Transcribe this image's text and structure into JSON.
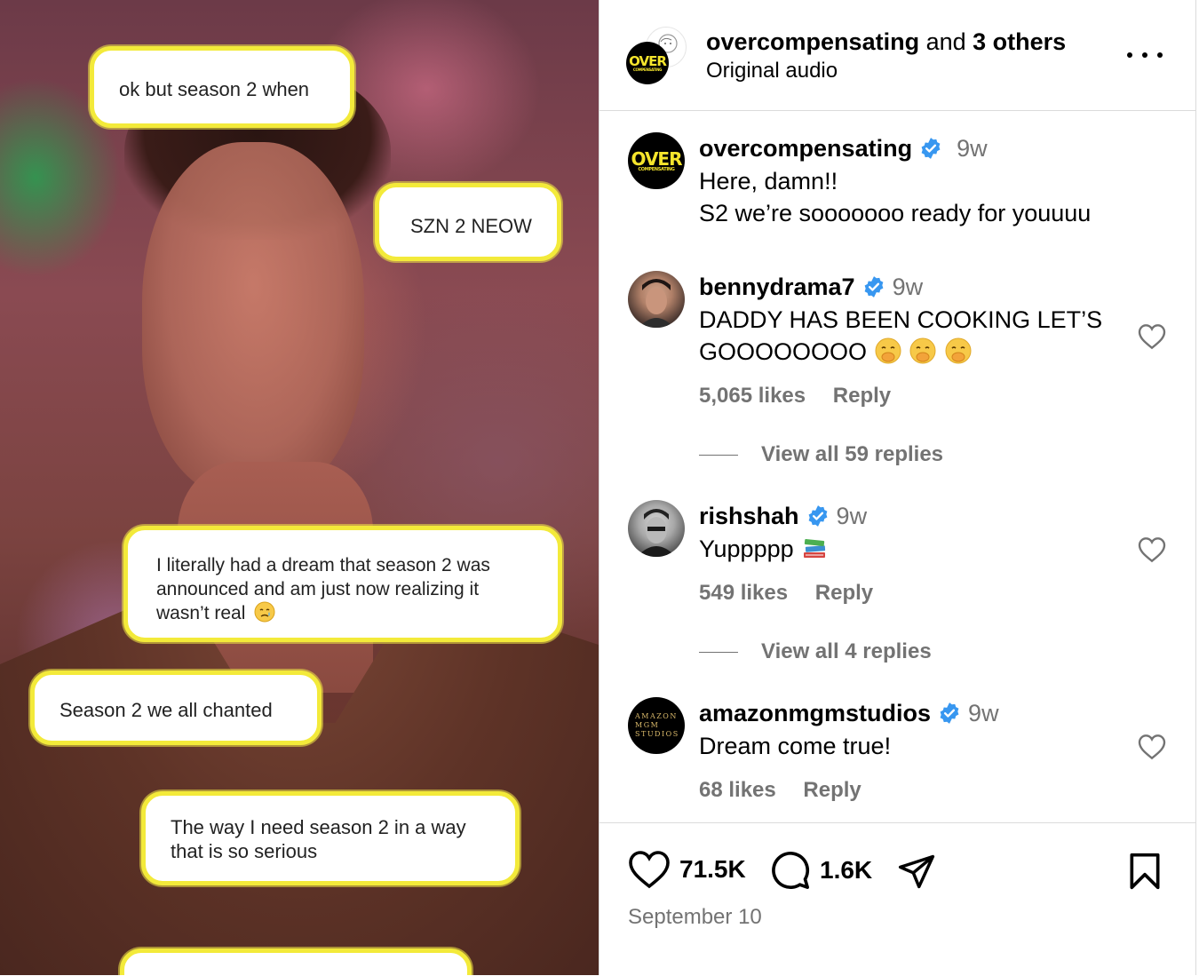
{
  "media": {
    "bubbles": [
      {
        "text": "ok but season 2 when"
      },
      {
        "text": "SZN 2 NEOW"
      },
      {
        "text": "I literally had a dream that season 2 was announced and am just now realizing it wasn’t real",
        "emoji": "crying-face"
      },
      {
        "text": "Season 2 we all chanted"
      },
      {
        "text": "The way I need season 2 in a way that is so serious"
      },
      {
        "text": ""
      }
    ]
  },
  "header": {
    "username": "overcompensating",
    "and_text": "and",
    "others": "3 others",
    "audio": "Original audio",
    "logo_big": "OVER",
    "logo_small": "COMPENSATING"
  },
  "caption": {
    "username": "overcompensating",
    "time": "9w",
    "line1": "Here, damn!!",
    "line2": "S2 we’re sooooooo ready for youuuu",
    "logo_big": "OVER",
    "logo_small": "COMPENSATING"
  },
  "comments": [
    {
      "username": "bennydrama7",
      "time": "9w",
      "text_line1": "DADDY HAS BEEN COOKING LET’S",
      "text_line2": "GOOOOOOOO",
      "emoji": "face-with-hand-over-mouth",
      "emoji_count": 3,
      "likes": "5,065 likes",
      "reply": "Reply",
      "view_replies": "View all 59 replies"
    },
    {
      "username": "rishshah",
      "time": "9w",
      "text": "Yuppppp",
      "emoji": "books",
      "likes": "549 likes",
      "reply": "Reply",
      "view_replies": "View all 4 replies"
    },
    {
      "username": "amazonmgmstudios",
      "time": "9w",
      "text": "Dream come true!",
      "likes": "68 likes",
      "reply": "Reply",
      "avatar_text": [
        "AMAZON",
        "MGM",
        "STUDIOS"
      ]
    }
  ],
  "actions": {
    "like_count": "71.5K",
    "comment_count": "1.6K",
    "date": "September 10"
  },
  "colors": {
    "bubble_border": "#f3ea3a",
    "verified": "#3897f0",
    "muted": "#737373",
    "divider": "#dbdbdb",
    "logo_yellow": "#f5e52c"
  }
}
